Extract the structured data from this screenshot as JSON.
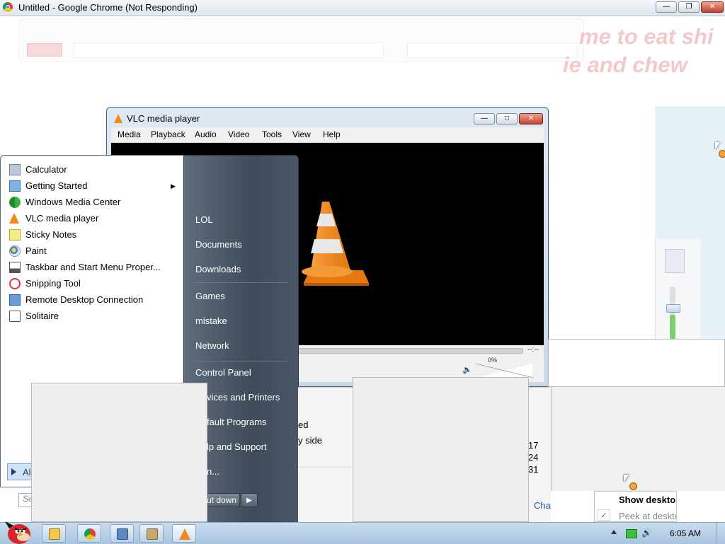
{
  "chrome": {
    "title": "Untitled - Google Chrome (Not Responding)",
    "bg_text_line1": "me to eat shi",
    "bg_text_line2": "ie and chew"
  },
  "vlc": {
    "title": "VLC media player",
    "menu": [
      "Media",
      "Playback",
      "Audio",
      "Video",
      "Tools",
      "View",
      "Help"
    ],
    "time": "--:--",
    "volume": "0%"
  },
  "start_menu": {
    "programs": [
      {
        "label": "Calculator",
        "icon": "calculator-icon"
      },
      {
        "label": "Getting Started",
        "icon": "getting-started-icon"
      },
      {
        "label": "Windows Media Center",
        "icon": "windows-media-center-icon"
      },
      {
        "label": "VLC media player",
        "icon": "vlc-cone-icon"
      },
      {
        "label": "Sticky Notes",
        "icon": "sticky-notes-icon"
      },
      {
        "label": "Paint",
        "icon": "paint-icon"
      },
      {
        "label": "Taskbar and Start Menu Proper...",
        "icon": "taskbar-properties-icon"
      },
      {
        "label": "Snipping Tool",
        "icon": "snipping-tool-icon"
      },
      {
        "label": "Remote Desktop Connection",
        "icon": "remote-desktop-icon"
      },
      {
        "label": "Solitaire",
        "icon": "solitaire-icon"
      }
    ],
    "all_programs": "Al",
    "search_placeholder": "Se",
    "right_links": [
      "LOL",
      "Documents",
      "Downloads",
      "Games",
      "mistake",
      "Network",
      "Control Panel",
      "vices and Printers",
      "fault Programs",
      "lp and Support",
      "n..."
    ],
    "shutdown": "ut down"
  },
  "underlying": {
    "text_a": "ed",
    "text_b": "y side",
    "nums": [
      "17",
      "24",
      "31"
    ],
    "link": "Cha"
  },
  "show_desktop": {
    "title": "Show desktop",
    "peek": "Peek at desktop"
  },
  "taskbar": {
    "clock": "6:05 AM"
  }
}
